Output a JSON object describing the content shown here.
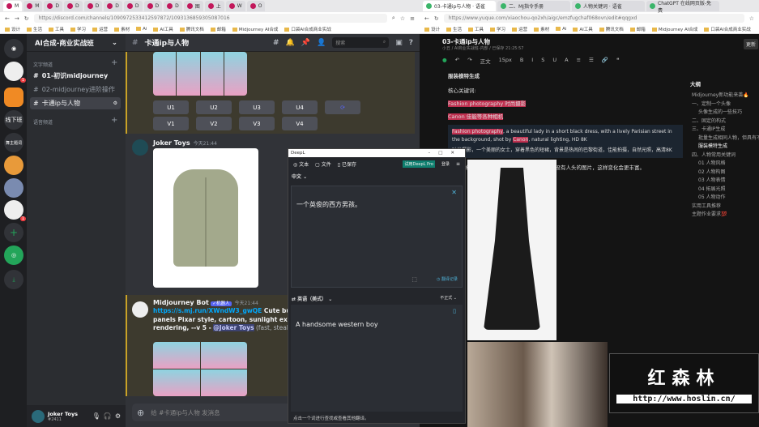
{
  "left_browser": {
    "tabs": [
      "M",
      "M",
      "D",
      "D",
      "D",
      "D",
      "D",
      "D",
      "D",
      "图",
      "上",
      "W",
      "O"
    ],
    "url": "https://discord.com/channels/1090972533412597872/1093136859305087016",
    "bookmarks": [
      "设计",
      "生活",
      "工具",
      "学习",
      "运营",
      "素材",
      "Ai",
      "AI工具",
      "腾讯文档",
      "邮箱",
      "Midjourney AI合成",
      "口袋AI合成商业实战"
    ]
  },
  "discord": {
    "server_name": "AI合成-商业实战班",
    "server_badges": [
      "1",
      "1"
    ],
    "offline_label": "线下班",
    "server_label2": "舞主题词",
    "category_text": "文字频道",
    "category_voice": "语音频道",
    "channels": [
      "01-初识midjourney",
      "02-midjourney进阶操作",
      "卡通ip与人物"
    ],
    "channel_title": "卡通ip与人物",
    "search_placeholder": "搜索",
    "upscale_buttons": [
      "U1",
      "U2",
      "U3",
      "U4"
    ],
    "variation_buttons": [
      "V1",
      "V2",
      "V3",
      "V4"
    ],
    "messages": [
      {
        "author": "Joker Toys",
        "time": "今天21:44"
      },
      {
        "author": "Midjourney Bot",
        "badge": "✓机器人",
        "time": "今天21:44",
        "link": "https://s.mj.run/XWndW3_gwQE",
        "text": " Cute bunny av 4 different expression panels Pixar style, cartoon, sunlight exposure, depth of field, 3D rendering, --v 5 - ",
        "mention": "@Joker Toys",
        "suffix": " (fast, stealth)"
      }
    ],
    "composer_placeholder": "给 #卡通ip与人物 发消息",
    "user": {
      "name": "Joker Toys",
      "tag": "#2411"
    }
  },
  "right_browser": {
    "tabs": [
      "03-卡通ip与人物 · 语雀",
      "二、MJ指令手册",
      "人物关键词 · 语雀",
      "ChatGPT 在线网页版-免费"
    ],
    "url": "https://www.yuque.com/xiaochou-qo2xh/aigc/emzfugchaf068ovn/edit#qqgxd",
    "doc_title": "03-卡通ip与人物",
    "breadcrumb": "小丑 / AI商业实战班-内部 / 已保存 21:25:57",
    "update_btn": "更新",
    "toolbar": {
      "style": "正文",
      "size": "15px"
    },
    "content": {
      "heading": "服装模特生成",
      "kw_label": "核心关键词:",
      "kw1": "Fashion photography 时尚摄影",
      "kw2": "Canon 佳能等各种相机",
      "prompt_hl1": "Fashion photography",
      "prompt_a": ", a beautiful lady in a short black dress, with a lively Parisian street in the background, shot by ",
      "prompt_hl2": "Canon",
      "prompt_b": ", natural lighting, HD 8K",
      "prompt_cn": "时尚摄影，一个美丽的女士，穿着黑色的短裙，背景是热闹的巴黎街道，佳能拍摄，自然光照，高清8K",
      "note": "结合作为参考图垫图生成，尽量用白底没有人头的图片，这样变化会更丰富。"
    },
    "outline_title": "大纲",
    "outline": [
      "Midjourney新功能来袭🔥",
      "一、定制一个头像",
      "头像生成的一些技巧",
      "二、固定的构式",
      "三、卡通IP生成",
      "批量生成相同人物，但具有不同",
      "服装模特生成",
      "四、人物常用关键词",
      "01 人物风格",
      "02 人物构图",
      "03 人物表情",
      "04 拓展光照",
      "05 人物动作",
      "实用工具推荐",
      "主题作业要求💯"
    ]
  },
  "deepl": {
    "title": "DeepL",
    "tabs": [
      "文本",
      "文件",
      "已保存"
    ],
    "pro_btn": "试用DeepL Pro",
    "login": "登录",
    "source_lang": "中文",
    "source_text": "一个英俊的西方男孩。",
    "history": "翻译记录",
    "target_lang": "英语（美式）",
    "formality": "不正式",
    "target_text": "A handsome western boy",
    "hint": "点击一个词进行查找或查看其他翻译。"
  },
  "watermark": {
    "title": "红森林",
    "url": "http://www.hoslin.cn/"
  }
}
